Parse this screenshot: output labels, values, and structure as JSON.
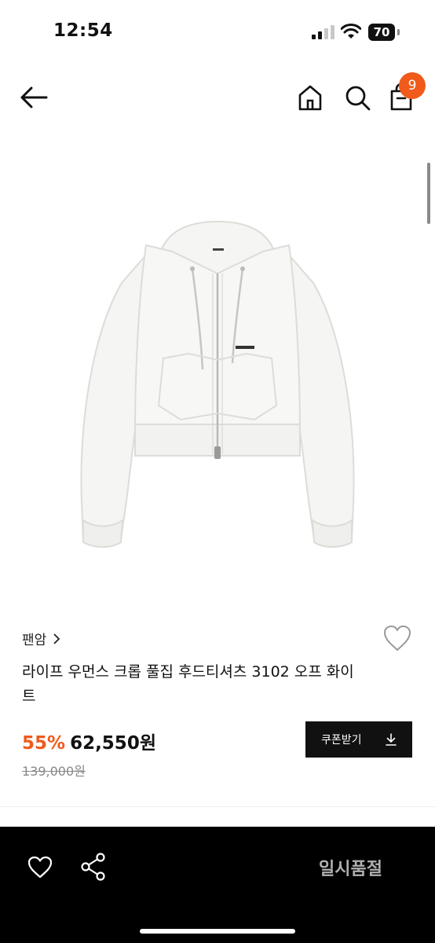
{
  "status_bar": {
    "time": "12:54",
    "battery": "70",
    "icons": [
      "signal-icon",
      "wifi-icon",
      "battery-icon"
    ]
  },
  "nav": {
    "cart_count": "9",
    "icons": [
      "back-arrow-icon",
      "home-icon",
      "search-icon",
      "cart-icon"
    ]
  },
  "product": {
    "brand": "팬암",
    "title": "라이프 우먼스 크롭 풀집 후드티셔츠 3102 오프 화이트",
    "discount": "55%",
    "price": "62,550원",
    "original_price": "139,000원",
    "coupon_label": "쿠폰받기"
  },
  "bottom_bar": {
    "soldout_label": "일시품절",
    "icons": [
      "heart-icon",
      "share-icon"
    ]
  },
  "colors": {
    "accent": "#f05a1a",
    "bottom_bar": "#000000",
    "coupon_button": "#111111"
  }
}
